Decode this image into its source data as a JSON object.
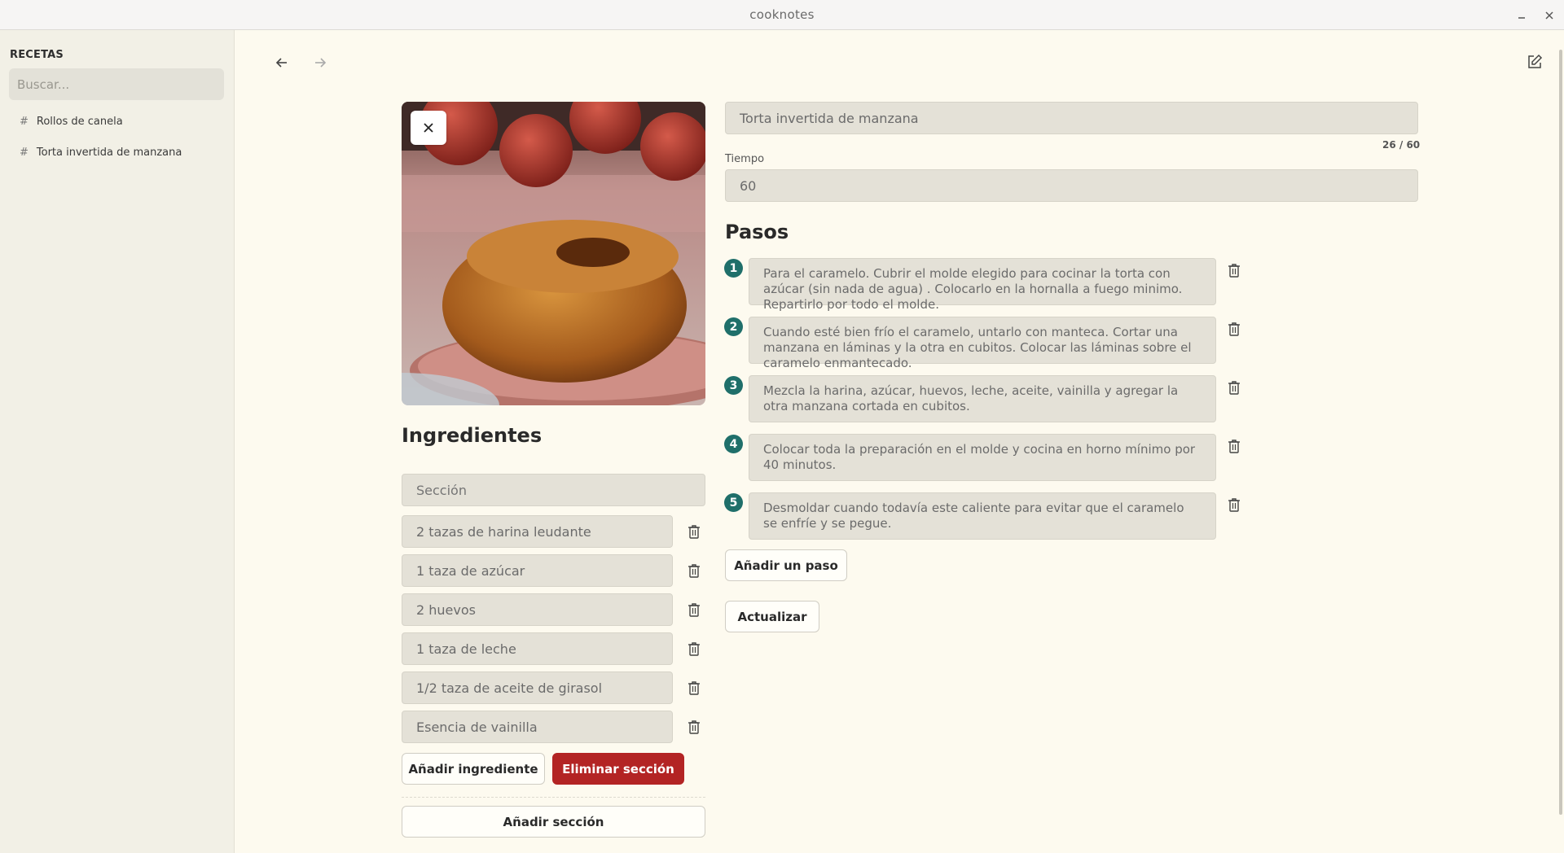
{
  "window": {
    "title": "cooknotes"
  },
  "sidebar": {
    "heading": "RECETAS",
    "search_placeholder": "Buscar...",
    "items": [
      {
        "label": "Rollos de canela"
      },
      {
        "label": "Torta invertida de manzana"
      }
    ]
  },
  "recipe": {
    "title_value": "Torta invertida de manzana",
    "title_counter": "26 / 60",
    "time_label": "Tiempo",
    "time_value": "60",
    "ingredients_heading": "Ingredientes",
    "section_placeholder": "Sección",
    "ingredients": [
      "2 tazas de harina leudante",
      "1 taza de azúcar",
      "2 huevos",
      "1 taza de leche",
      "1/2 taza de aceite de girasol",
      "Esencia de vainilla"
    ],
    "add_ingredient_label": "Añadir ingrediente",
    "delete_section_label": "Eliminar sección",
    "add_section_label": "Añadir sección",
    "steps_heading": "Pasos",
    "steps": [
      {
        "num": "1",
        "text": "Para el caramelo. Cubrir el molde elegido para cocinar la torta con azúcar (sin nada de agua) . Colocarlo en la hornalla a fuego minimo. Repartirlo por todo el molde."
      },
      {
        "num": "2",
        "text": "Cuando esté bien frío el caramelo, untarlo con manteca. Cortar una manzana en láminas y la otra en cubitos. Colocar las láminas sobre el caramelo enmantecado."
      },
      {
        "num": "3",
        "text": "Mezcla la harina, azúcar, huevos, leche, aceite, vainilla y agregar la otra manzana cortada en cubitos."
      },
      {
        "num": "4",
        "text": "Colocar toda la preparación en el molde y cocina en horno mínimo por 40 minutos."
      },
      {
        "num": "5",
        "text": "Desmoldar cuando todavía este caliente para evitar que el caramelo se enfríe y se pegue."
      }
    ],
    "add_step_label": "Añadir un paso",
    "update_label": "Actualizar"
  },
  "colors": {
    "accent_teal": "#1f6f6a",
    "danger_red": "#b32424",
    "background": "#fdfaef"
  }
}
